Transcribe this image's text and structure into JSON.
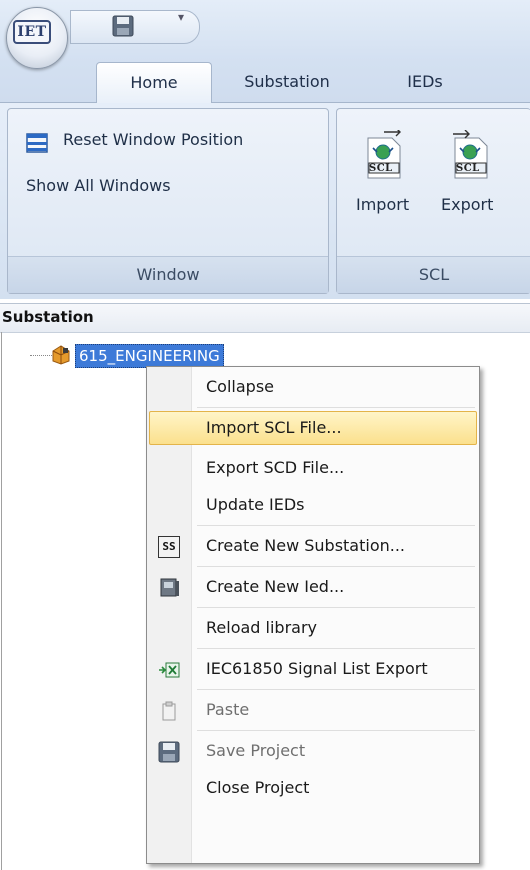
{
  "app": {
    "logo_text": "IET",
    "quick_access": {
      "save_icon": "save-icon",
      "dropdown_glyph": "▾"
    }
  },
  "tabs": [
    "Home",
    "Substation",
    "IEDs"
  ],
  "ribbon": {
    "window_group": {
      "reset_label": "Reset Window Position",
      "show_all_label": "Show All Windows",
      "group_label": "Window"
    },
    "scl_group": {
      "import_label": "Import",
      "export_label": "Export",
      "icon_text": "SCL",
      "group_label": "SCL"
    }
  },
  "panel": {
    "title": "Substation",
    "tree_root": "615_ENGINEERING"
  },
  "context_menu": [
    {
      "label": "Collapse",
      "icon": "",
      "state": "normal"
    },
    {
      "label": "Import SCL File...",
      "icon": "",
      "state": "hover"
    },
    {
      "label": "Export SCD File...",
      "icon": "",
      "state": "normal"
    },
    {
      "label": "Update IEDs",
      "icon": "",
      "state": "normal"
    },
    {
      "label": "Create New Substation...",
      "icon": "substation-icon",
      "state": "normal"
    },
    {
      "label": "Create New Ied...",
      "icon": "ied-device-icon",
      "state": "normal"
    },
    {
      "label": "Reload library",
      "icon": "",
      "state": "normal"
    },
    {
      "label": "IEC61850 Signal List Export",
      "icon": "excel-export-icon",
      "state": "normal"
    },
    {
      "label": "Paste",
      "icon": "clipboard-icon",
      "state": "disabled"
    },
    {
      "label": "Save Project",
      "icon": "save-icon",
      "state": "disabled"
    },
    {
      "label": "Close Project",
      "icon": "",
      "state": "normal"
    }
  ],
  "context_menu_substation_glyph": "SS",
  "colors": {
    "selection": "#3d7ad8",
    "hover_fill": "#fbe08d",
    "hover_border": "#e3b44a",
    "ribbon": "#dce6f3"
  }
}
